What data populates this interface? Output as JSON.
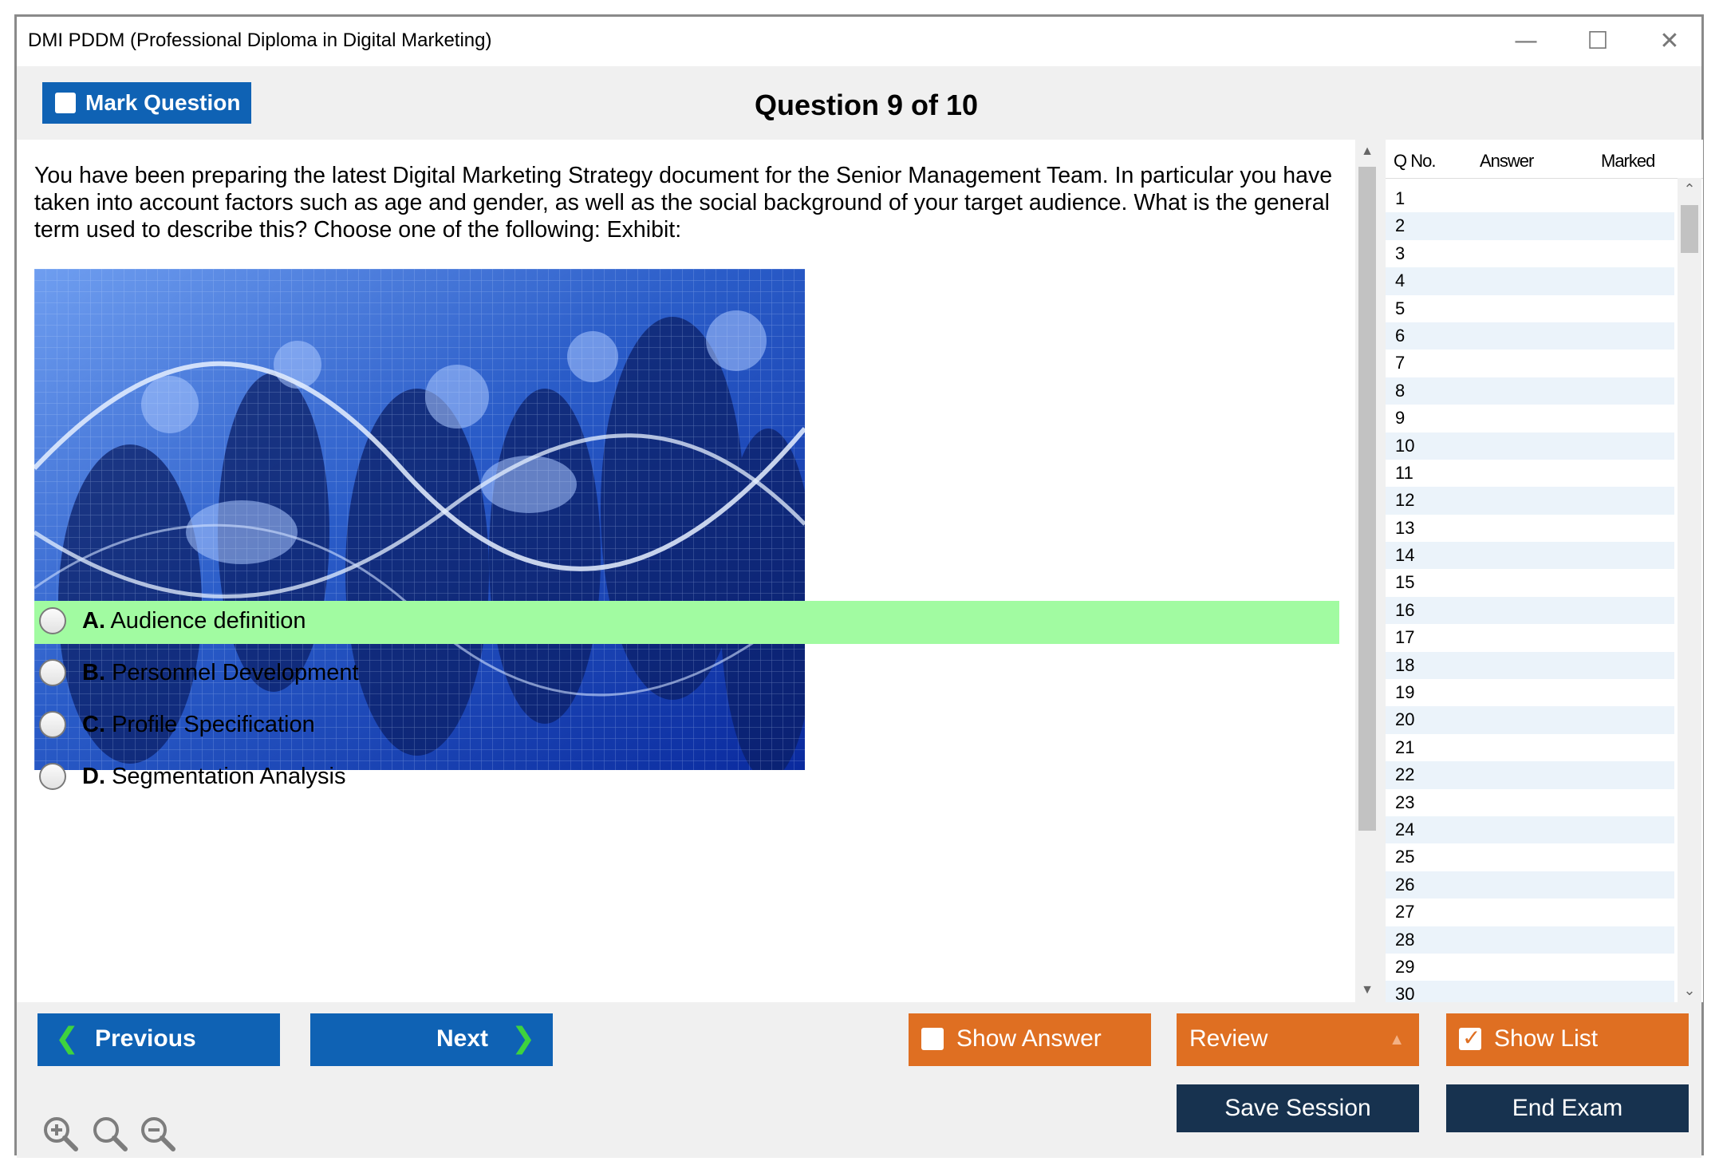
{
  "window": {
    "title": "DMI PDDM (Professional Diploma in Digital Marketing)"
  },
  "header": {
    "mark_label": "Mark Question",
    "question_title": "Question 9 of 10"
  },
  "question": {
    "text": "You have been preparing the latest Digital Marketing Strategy document for the Senior Management Team. In particular you have taken into account factors such as age and gender, as well as the social background of your target audience. What is the general term used to describe this? Choose one of the following: Exhibit:",
    "options": [
      {
        "letter": "A.",
        "text": "Audience definition",
        "highlighted": true
      },
      {
        "letter": "B.",
        "text": "Personnel Development",
        "highlighted": false
      },
      {
        "letter": "C.",
        "text": "Profile Specification",
        "highlighted": false
      },
      {
        "letter": "D.",
        "text": "Segmentation Analysis",
        "highlighted": false
      }
    ]
  },
  "question_list": {
    "headers": {
      "qno": "Q No.",
      "answer": "Answer",
      "marked": "Marked"
    },
    "rows": [
      "1",
      "2",
      "3",
      "4",
      "5",
      "6",
      "7",
      "8",
      "9",
      "10",
      "11",
      "12",
      "13",
      "14",
      "15",
      "16",
      "17",
      "18",
      "19",
      "20",
      "21",
      "22",
      "23",
      "24",
      "25",
      "26",
      "27",
      "28",
      "29",
      "30"
    ]
  },
  "footer": {
    "previous_label": "Previous",
    "next_label": "Next",
    "show_answer_label": "Show Answer",
    "review_label": "Review",
    "show_list_label": "Show List",
    "save_session_label": "Save Session",
    "end_exam_label": "End Exam"
  },
  "icons": {
    "zoom_in": "zoom-in-icon",
    "zoom_reset": "zoom-reset-icon",
    "zoom_out": "zoom-out-icon"
  },
  "colors": {
    "primary_blue": "#0f62b4",
    "orange": "#df6f22",
    "dark_navy": "#17324f",
    "correct_highlight": "#a1fba1"
  }
}
